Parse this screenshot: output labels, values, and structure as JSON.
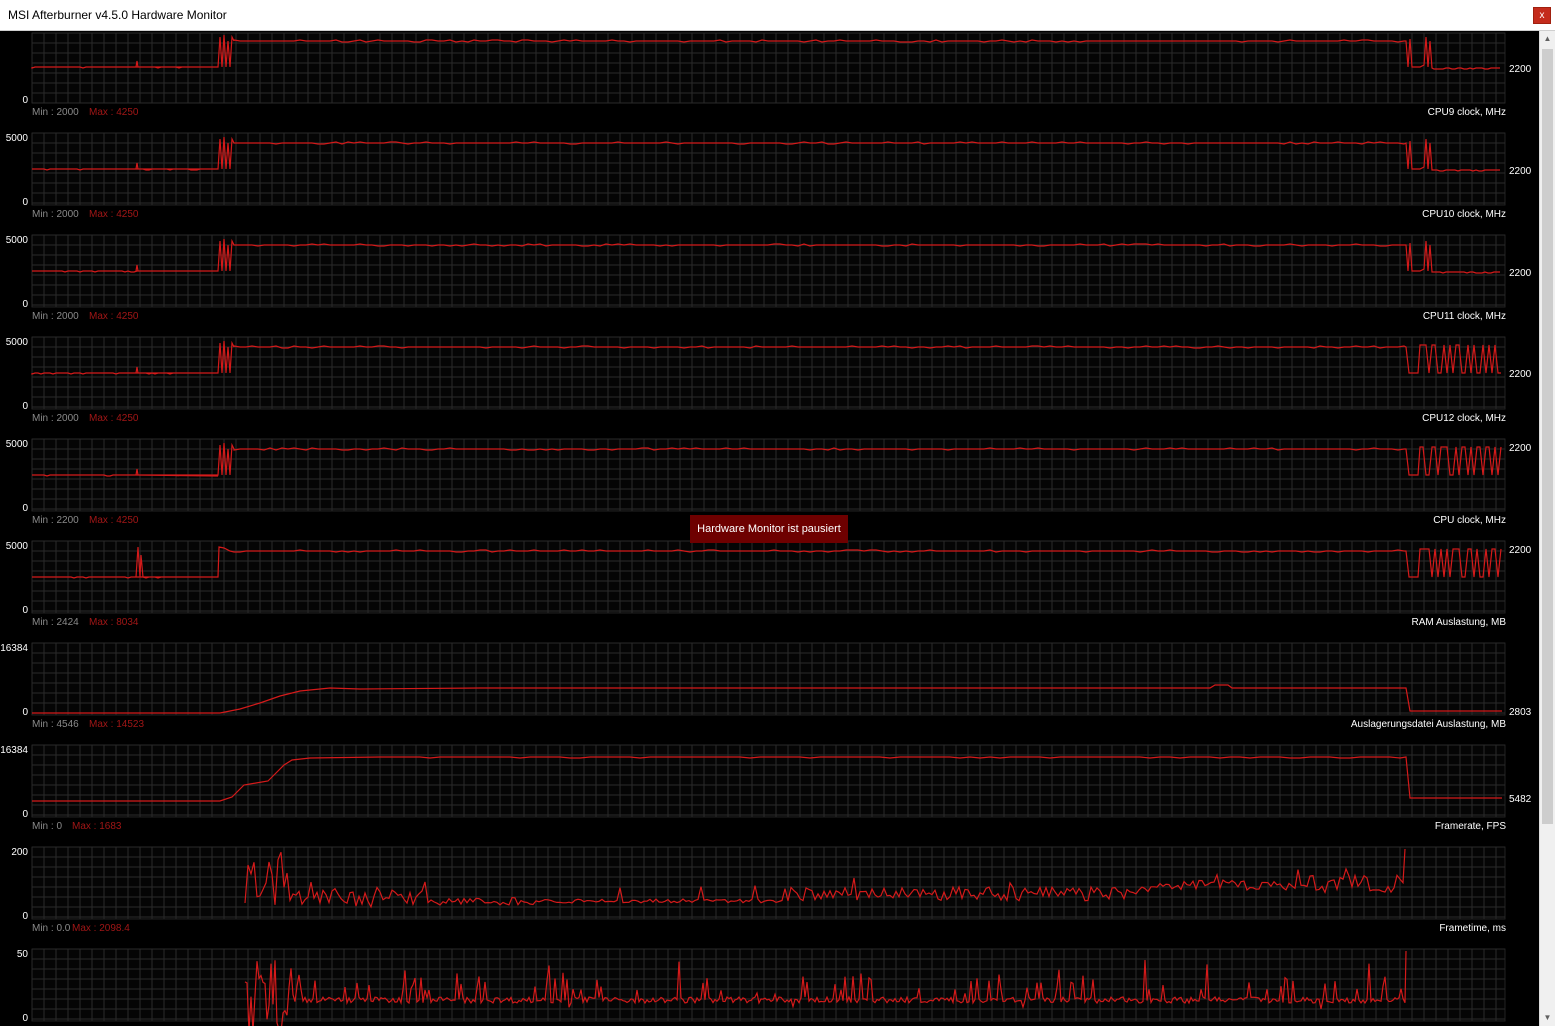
{
  "window": {
    "title": "MSI Afterburner v4.5.0 Hardware Monitor",
    "close_label": "x"
  },
  "paused_label": "Hardware Monitor ist pausiert",
  "colors": {
    "line": "#d41a1a",
    "grid": "#2a2a2a",
    "min_text": "#8a8a8a",
    "max_text": "#a01616",
    "label_text": "#ffffff",
    "background": "#000000"
  },
  "graphs": [
    {
      "id": "cpu8",
      "title": "",
      "min_label": "",
      "max_label": "",
      "y_max": "",
      "y_min": "0",
      "current": "2200",
      "shape": "cpu_a"
    },
    {
      "id": "cpu9",
      "title": "CPU9 clock, MHz",
      "min_label": "Min : 2000",
      "max_label": "Max : 4250",
      "y_max": "5000",
      "y_min": "0",
      "current": "2200",
      "shape": "cpu_a"
    },
    {
      "id": "cpu10",
      "title": "CPU10 clock, MHz",
      "min_label": "Min : 2000",
      "max_label": "Max : 4250",
      "y_max": "5000",
      "y_min": "0",
      "current": "2200",
      "shape": "cpu_a"
    },
    {
      "id": "cpu11",
      "title": "CPU11 clock, MHz",
      "min_label": "Min : 2000",
      "max_label": "Max : 4250",
      "y_max": "5000",
      "y_min": "0",
      "current": "2200",
      "shape": "cpu_b"
    },
    {
      "id": "cpu12",
      "title": "CPU12 clock, MHz",
      "min_label": "Min : 2000",
      "max_label": "Max : 4250",
      "y_max": "5000",
      "y_min": "0",
      "current": "2200",
      "shape": "cpu_b"
    },
    {
      "id": "cpu",
      "title": "CPU clock, MHz",
      "min_label": "Min : 2200",
      "max_label": "Max : 4250",
      "y_max": "5000",
      "y_min": "0",
      "current": "2200",
      "shape": "cpu_c"
    },
    {
      "id": "ram",
      "title": "RAM Auslastung, MB",
      "min_label": "Min : 2424",
      "max_label": "Max : 8034",
      "y_max": "16384",
      "y_min": "0",
      "current": "2803",
      "shape": "ram"
    },
    {
      "id": "pagefile",
      "title": "Auslagerungsdatei Auslastung, MB",
      "min_label": "Min : 4546",
      "max_label": "Max : 14523",
      "y_max": "16384",
      "y_min": "0",
      "current": "5482",
      "shape": "pagefile"
    },
    {
      "id": "framerate",
      "title": "Framerate, FPS",
      "min_label": "Min : 0",
      "max_label": "Max : 1683",
      "y_max": "200",
      "y_min": "0",
      "current": "",
      "shape": "fps"
    },
    {
      "id": "frametime",
      "title": "Frametime, ms",
      "min_label": "Min : 0.0",
      "max_label": "Max : 2098.4",
      "y_max": "50",
      "y_min": "0",
      "current": "",
      "shape": "frametime"
    }
  ]
}
